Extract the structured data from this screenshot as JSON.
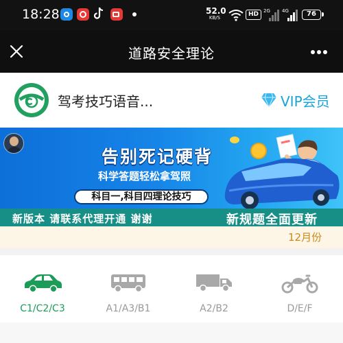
{
  "status_bar": {
    "time": "18:28",
    "net_speed": "52.0",
    "net_unit": "KB/S",
    "hd_badge": "HD",
    "sim1_label": "2G",
    "sim2_label": "4G",
    "battery": "76",
    "app_icons": [
      "app-icon-blue",
      "app-icon-red",
      "tiktok-icon",
      "video-icon"
    ]
  },
  "header": {
    "title": "道路安全理论"
  },
  "brand": {
    "name": "驾考技巧语音...",
    "vip_label": "VIP会员"
  },
  "banner": {
    "headline": "告别死记硬背",
    "subline": "科学答题轻松拿驾照",
    "pill": "科目一,科目四理论技巧",
    "bottom_left": "新版本 请联系代理开通 谢谢",
    "bottom_right": "新规题全面更新"
  },
  "notice": {
    "text": "12月份"
  },
  "license_tabs": [
    {
      "label": "C1/C2/C3",
      "icon": "car-icon",
      "active": true
    },
    {
      "label": "A1/A3/B1",
      "icon": "bus-icon",
      "active": false
    },
    {
      "label": "A2/B2",
      "icon": "truck-icon",
      "active": false
    },
    {
      "label": "D/E/F",
      "icon": "motorcycle-icon",
      "active": false
    }
  ],
  "colors": {
    "accent": "#1d9b58",
    "vip": "#1aa3d9",
    "notice": "#c98a18",
    "header_bg": "#0f0f0f"
  }
}
